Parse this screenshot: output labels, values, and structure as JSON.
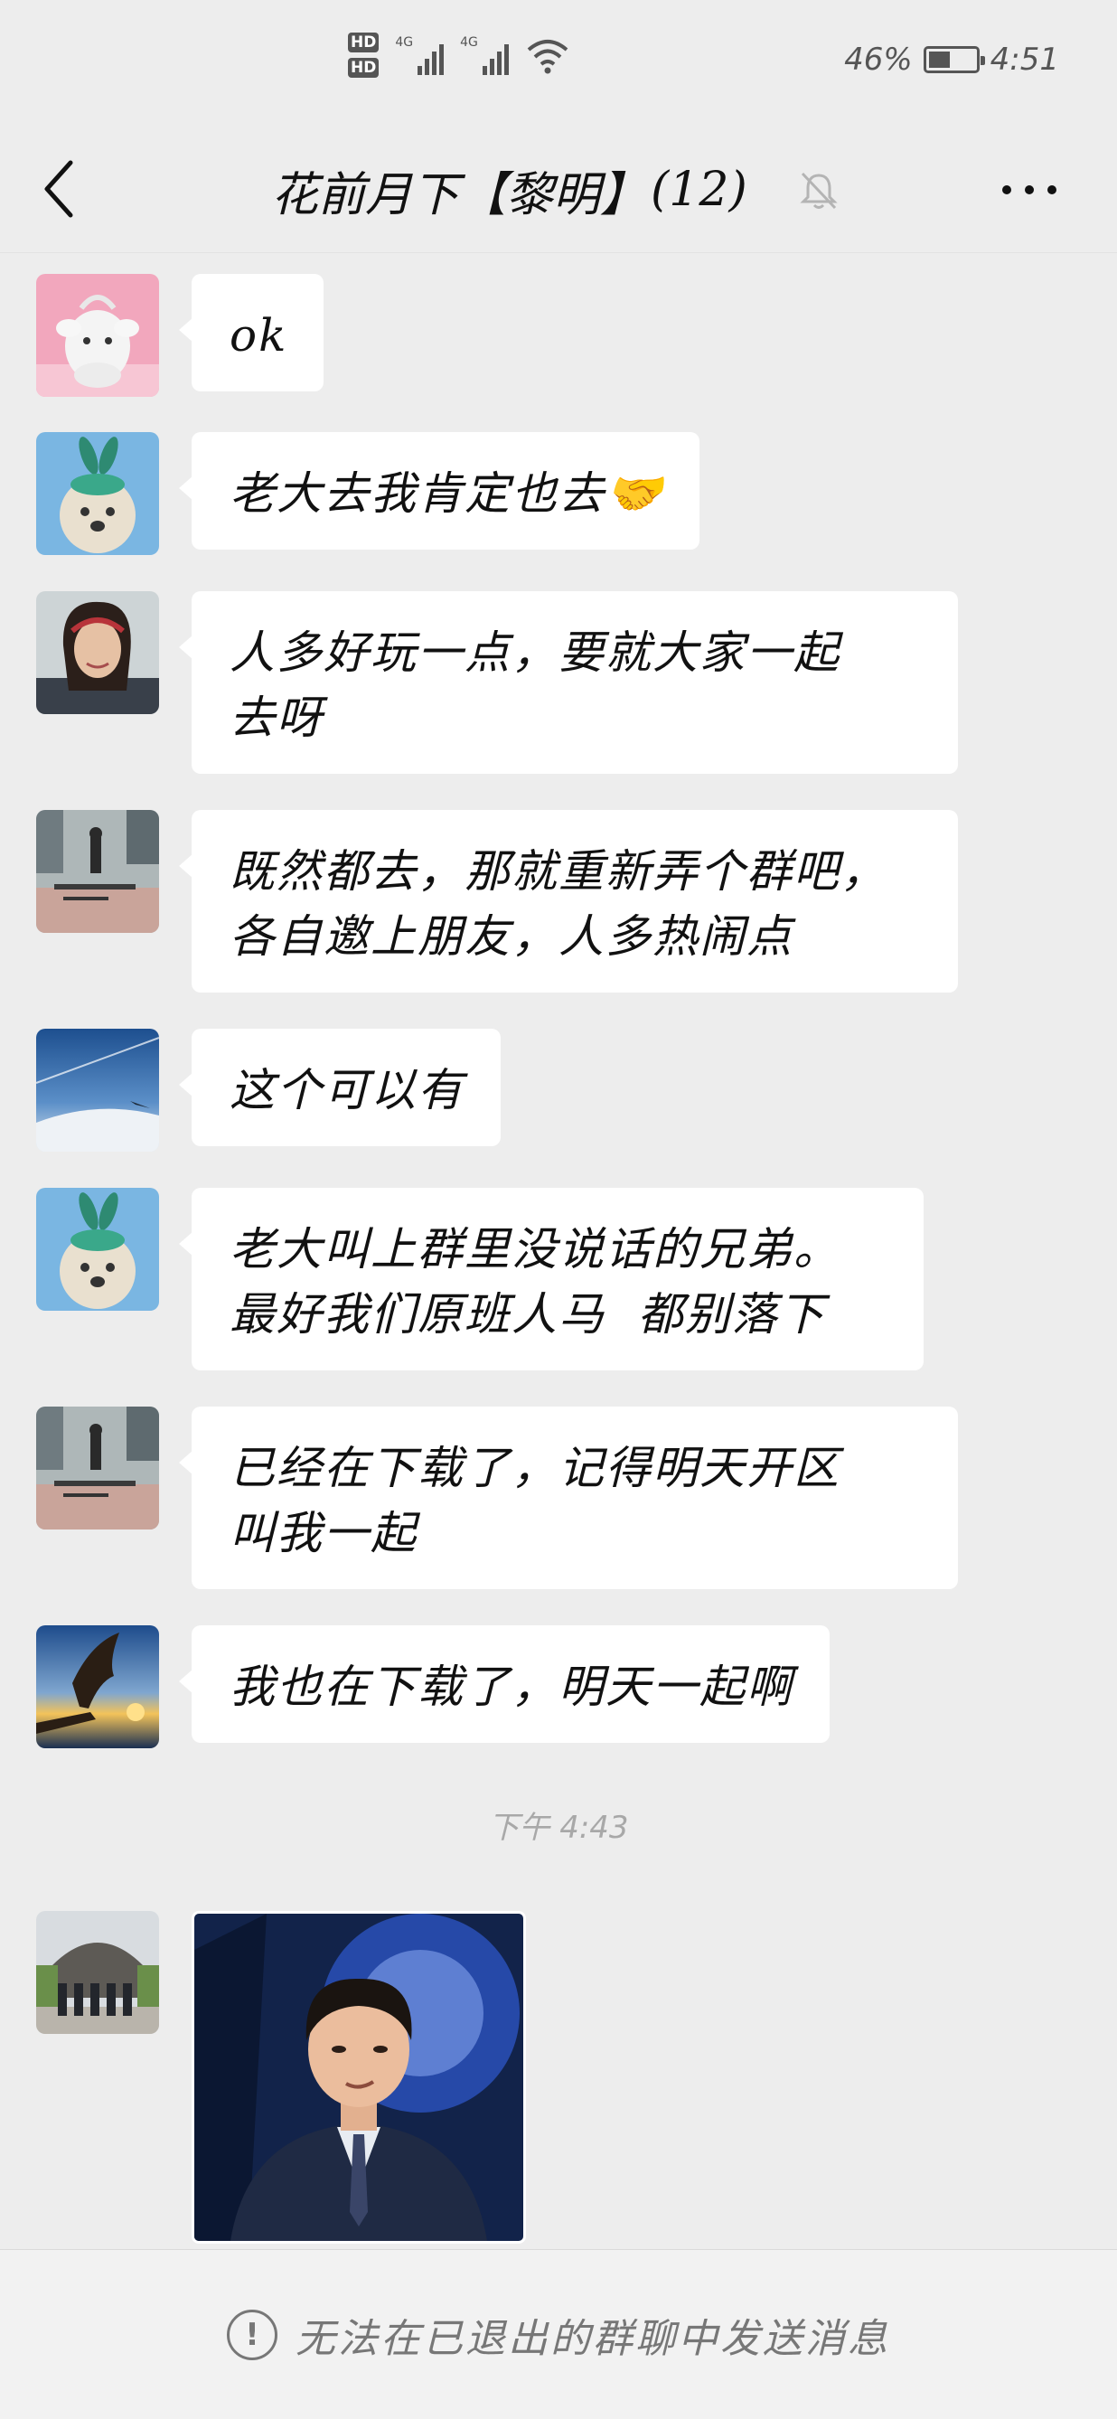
{
  "status_bar": {
    "hd1": "HD",
    "hd2": "HD",
    "net1": "4G",
    "net2": "4G",
    "battery_percent": "46%",
    "battery_level": 0.46,
    "time": "4:51"
  },
  "header": {
    "title": "花前月下【黎明】",
    "member_count": "(12)",
    "back_icon": "chevron-left-icon",
    "mute_icon": "bell-off-icon",
    "more_icon": "more-dots-icon"
  },
  "messages": [
    {
      "avatar": "pink-plush-toy-avatar",
      "text": "ok"
    },
    {
      "avatar": "dog-with-bunny-ears-avatar",
      "text": "老大去我肯定也去🤝"
    },
    {
      "avatar": "smiling-woman-avatar",
      "text_lines": [
        "人多好玩一点，要就大家一起",
        "去呀"
      ]
    },
    {
      "avatar": "rooftop-city-avatar",
      "text_lines": [
        "既然都去，那就重新弄个群吧，",
        "各自邀上朋友，人多热闹点"
      ]
    },
    {
      "avatar": "airplane-sky-avatar",
      "text": "这个可以有"
    },
    {
      "avatar": "dog-with-bunny-ears-avatar",
      "text_lines": [
        "老大叫上群里没说话的兄弟。",
        "最好我们原班人马  都别落下"
      ]
    },
    {
      "avatar": "rooftop-city-avatar",
      "text_lines": [
        "已经在下载了，记得明天开区",
        "叫我一起"
      ]
    },
    {
      "avatar": "eagle-sunset-avatar",
      "text": "我也在下载了，明天一起啊"
    }
  ],
  "timestamp": "下午 4:43",
  "photo_message": {
    "avatar": "group-photo-building-avatar",
    "image": "man-in-suit-sticker-image"
  },
  "footer": {
    "notice": "无法在已退出的群聊中发送消息",
    "icon": "exclamation-circle-icon"
  },
  "colors": {
    "background": "#ededed",
    "bubble": "#ffffff",
    "footer_bg": "#f2f2f2",
    "muted_text": "#777777"
  }
}
